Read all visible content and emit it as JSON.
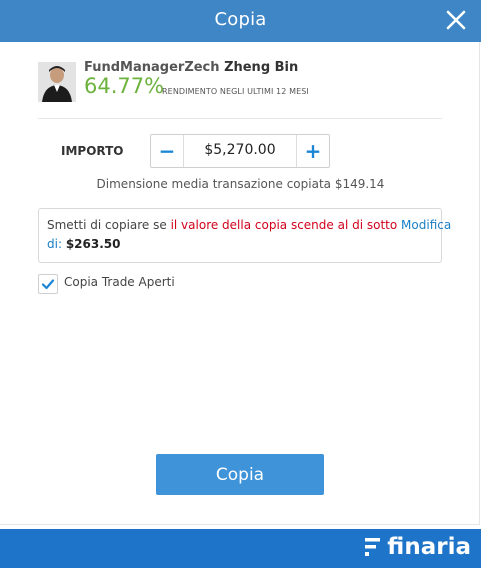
{
  "header": {
    "title": "Copia"
  },
  "trader": {
    "handle": "FundManagerZech",
    "full_name": "Zheng Bin",
    "gain": "64.77%",
    "gain_label": "RENDIMENTO NEGLI ULTIMI 12 MESI"
  },
  "amount": {
    "label": "IMPORTO",
    "value": "$5,270.00",
    "minus": "−",
    "plus": "+"
  },
  "avg_trade_size": "Dimensione media transazione copiata $149.14",
  "stop_copy": {
    "prefix": "Smetti di copiare se ",
    "condition": "il valore della copia scende al di sotto",
    "edit_link_part1": "Modifica",
    "edit_link_part2": "di:",
    "value": "$263.50"
  },
  "copy_open_trades": {
    "label": "Copia Trade Aperti",
    "checked": true
  },
  "copy_button": "Copia",
  "footer": {
    "brand": "finaria"
  },
  "colors": {
    "header": "#3f86c7",
    "gain": "#6cb33e",
    "red_text": "#d0021b",
    "link": "#1b7fc4",
    "button": "#3f93d8",
    "footer": "#1e74c8"
  },
  "icons": {
    "close": "close-icon",
    "check": "checkmark-icon",
    "logo": "finaria-logo-icon"
  }
}
